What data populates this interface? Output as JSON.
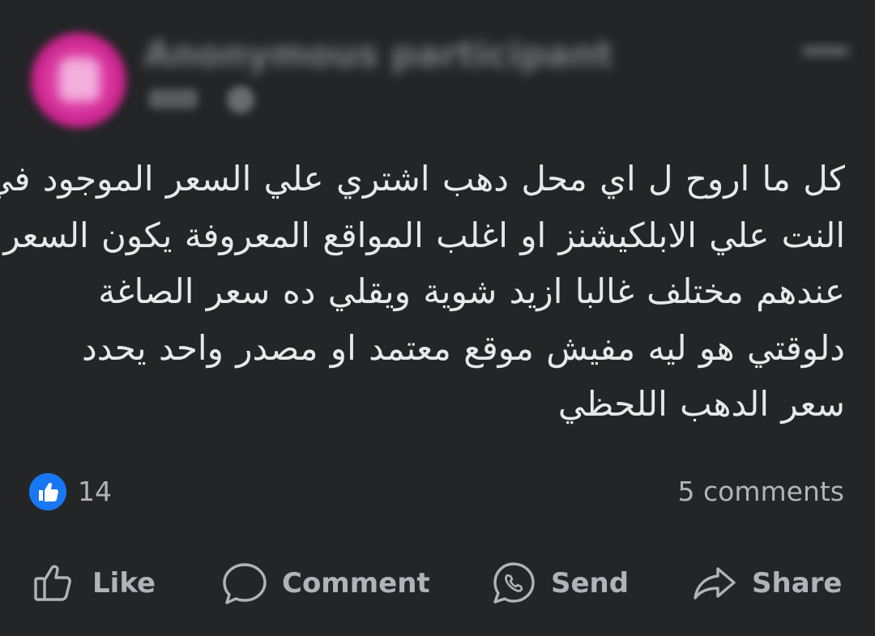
{
  "post": {
    "author": "Anonymous participant",
    "text_lines": [
      "كل ما اروح ل اي محل دهب اشتري علي السعر الموجود في",
      "النت علي الابلكيشنز او اغلب المواقع المعروفة يكون السعر",
      "عندهم مختلف غالبا ازيد شوية ويقلي ده سعر الصاغة",
      "دلوقتي هو ليه مفيش موقع معتمد او مصدر واحد يحدد",
      "سعر الدهب اللحظي"
    ]
  },
  "reactions": {
    "icon": "like-icon",
    "count": "14"
  },
  "comments_label": "5 comments",
  "actions": {
    "like": "Like",
    "comment": "Comment",
    "send": "Send",
    "share": "Share"
  },
  "colors": {
    "background": "#242527",
    "text": "#e4e6eb",
    "muted": "#b0b3b8",
    "accent": "#1877f2",
    "avatar": "#d9379f"
  }
}
